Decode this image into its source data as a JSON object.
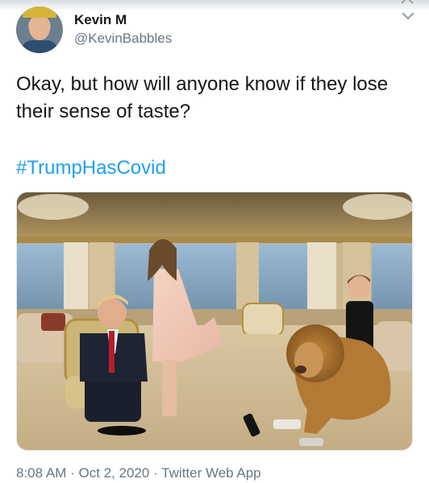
{
  "tweet": {
    "author": {
      "display_name": "Kevin M",
      "handle": "@KevinBabbles"
    },
    "text": "Okay, but how will anyone know if they lose their sense of taste?",
    "hashtag": "#TrumpHasCovid",
    "timestamp": "8:08 AM · Oct 2, 2020 · Twitter Web App"
  },
  "colors": {
    "link": "#1da1f2",
    "secondary_text": "#657786",
    "primary_text": "#14171a"
  },
  "icons": {
    "more_menu": "chevron-down-icon",
    "top_close": "close-icon"
  }
}
